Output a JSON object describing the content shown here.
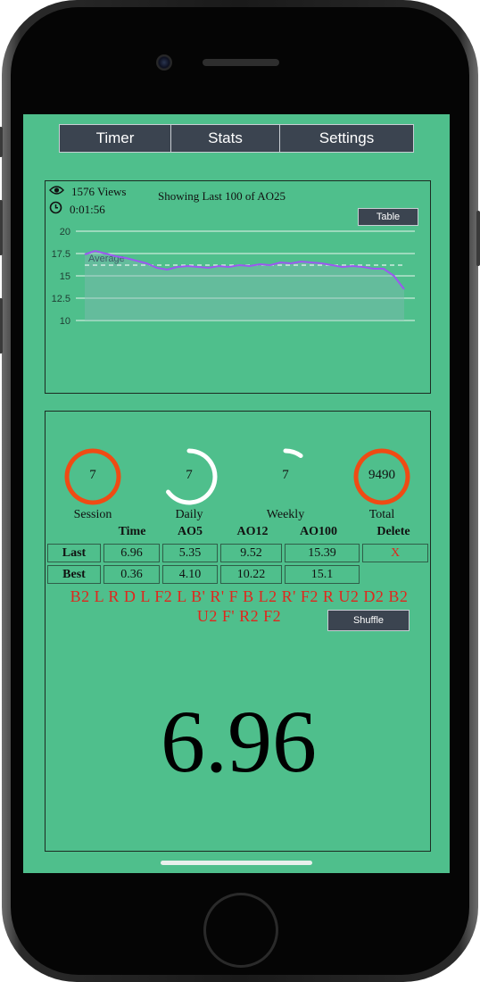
{
  "nav": {
    "tabs": [
      {
        "label": "Timer"
      },
      {
        "label": "Stats"
      },
      {
        "label": "Settings"
      }
    ]
  },
  "graph": {
    "views": "1576 Views",
    "duration": "0:01:56",
    "title": "Showing Last 100 of AO25",
    "table_button": "Table",
    "average_label": "Average"
  },
  "chart_data": {
    "type": "line",
    "title": "Showing Last 100 of AO25",
    "yticks": [
      "20",
      "17.5",
      "15",
      "12.5",
      "10"
    ],
    "ylim": [
      10,
      20
    ],
    "grid": true,
    "average": 16.2,
    "series": [
      {
        "values": [
          17.4,
          17.8,
          17.5,
          17.2,
          17.0,
          16.7,
          16.4,
          15.9,
          15.7,
          16.0,
          16.1,
          16.0,
          15.9,
          16.1,
          16.0,
          16.2,
          16.1,
          16.3,
          16.2,
          16.5,
          16.4,
          16.6,
          16.5,
          16.4,
          16.2,
          16.0,
          16.1,
          16.0,
          15.8,
          15.8,
          15.0,
          13.5
        ]
      }
    ],
    "line_color": "#9b59f0",
    "area_color": "#7fb8b0"
  },
  "stats": {
    "gauges": [
      {
        "value": "7",
        "label": "Session",
        "color": "#ef4b14",
        "fraction": 1.0
      },
      {
        "value": "7",
        "label": "Daily",
        "color": "#ffffff",
        "fraction": 0.65
      },
      {
        "value": "7",
        "label": "Weekly",
        "color": "#ffffff",
        "fraction": 0.1
      },
      {
        "value": "9490",
        "label": "Total",
        "color": "#ef4b14",
        "fraction": 1.0
      }
    ],
    "columns": [
      "Time",
      "AO5",
      "AO12",
      "AO100",
      "Delete"
    ],
    "rows": [
      {
        "label": "Last",
        "cells": [
          "6.96",
          "5.35",
          "9.52",
          "15.39"
        ],
        "delete": "X"
      },
      {
        "label": "Best",
        "cells": [
          "0.36",
          "4.10",
          "10.22",
          "15.1"
        ]
      }
    ],
    "scramble_line1": "B2 L R D L F2 L B' R' F B L2 R' F2 R U2 D2 B2",
    "scramble_line2": "U2 F' R2 F2",
    "shuffle_button": "Shuffle",
    "current_time": "6.96"
  }
}
